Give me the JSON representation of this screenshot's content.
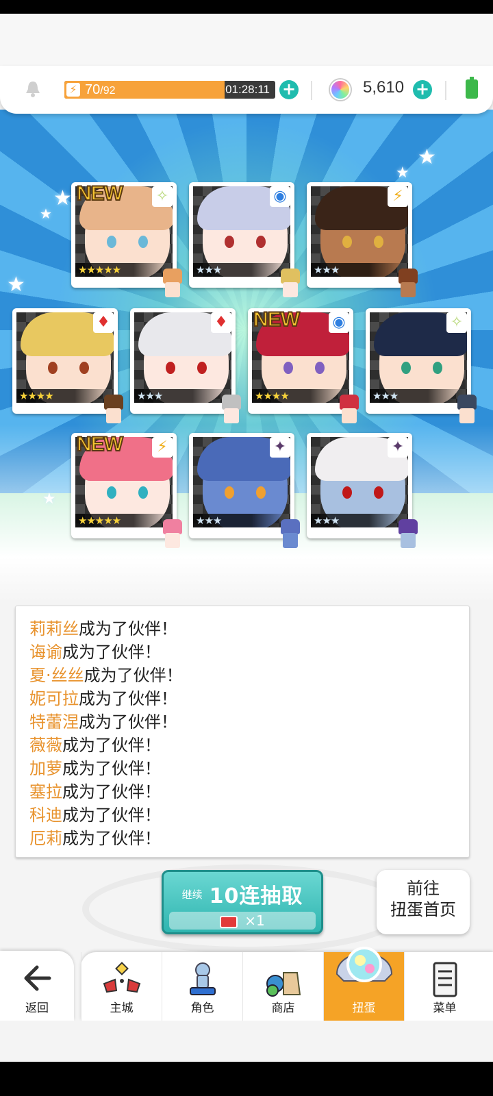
{
  "hud": {
    "stamina_current": "70",
    "stamina_max": "/92",
    "stamina_fraction": 0.76,
    "timer": "01:28:11",
    "gems": "5,610"
  },
  "cards": [
    {
      "new": "NEW",
      "stars": "★★★★★",
      "element": "light",
      "color": "gold"
    },
    {
      "new": "",
      "stars": "★★★",
      "element": "water",
      "color": "silver"
    },
    {
      "new": "",
      "stars": "★★★",
      "element": "lightning",
      "color": "silver"
    },
    {
      "new": "",
      "stars": "★★★★",
      "element": "fire",
      "color": "gold"
    },
    {
      "new": "",
      "stars": "★★★",
      "element": "fire",
      "color": "silver"
    },
    {
      "new": "NEW",
      "stars": "★★★★",
      "element": "water",
      "color": "gold"
    },
    {
      "new": "",
      "stars": "★★★",
      "element": "light",
      "color": "silver"
    },
    {
      "new": "NEW",
      "stars": "★★★★★",
      "element": "lightning",
      "color": "gold"
    },
    {
      "new": "",
      "stars": "★★★",
      "element": "dark",
      "color": "silver"
    },
    {
      "new": "",
      "stars": "★★★",
      "element": "dark",
      "color": "silver"
    }
  ],
  "log": {
    "suffix": "成为了伙伴！",
    "names": [
      "莉莉丝",
      "诲谕",
      "夏·丝丝",
      "妮可拉",
      "特蕾涅",
      "薇薇",
      "加萝",
      "塞拉",
      "科迪",
      "厄莉"
    ]
  },
  "actions": {
    "continue_label": "继续",
    "pull_label": "10连抽取",
    "cost_label": "×1",
    "goto_line1": "前往",
    "goto_line2": "扭蛋首页"
  },
  "nav": {
    "back": "返回",
    "tabs": [
      "主城",
      "角色",
      "商店",
      "扭蛋",
      "菜单"
    ],
    "active": "扭蛋"
  }
}
